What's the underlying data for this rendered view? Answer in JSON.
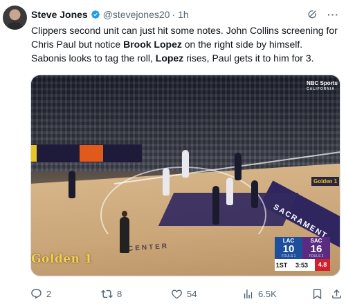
{
  "tweet": {
    "author": {
      "name": "Steve Jones",
      "handle": "@stevejones20",
      "separator": "·",
      "time": "1h",
      "verified": true
    },
    "text_parts": [
      "Clippers second unit can just hit some notes. John Collins screening for Chris Paul but notice ",
      "Brook Lopez",
      " on the right side by himself. Sabonis looks to tag the roll, ",
      "Lopez",
      " rises, Paul gets it to him for 3."
    ],
    "media": {
      "broadcaster": "NBC Sports",
      "broadcaster_region": "CALIFORNIA",
      "court_text": "Golden 1",
      "court_center": "CENTER",
      "sideline_text": "SACRAMENT",
      "arena_sign": "Golden 1",
      "scorebug": {
        "home_abbr": "LAC",
        "home_score": "10",
        "home_fouls": "FOULS 1",
        "away_abbr": "SAC",
        "away_score": "16",
        "away_fouls": "FOULS 2",
        "period": "1ST",
        "clock": "3:53",
        "shot_clock": "4.8"
      }
    },
    "actions": {
      "replies": "2",
      "reposts": "8",
      "likes": "54",
      "views": "6.5K"
    }
  },
  "colors": {
    "verified": "#1d9bf0",
    "text": "#0f1419",
    "secondary": "#536471",
    "lac": "#1d4f9c",
    "sac": "#5b2b82"
  },
  "icons": [
    "verified-badge-icon",
    "grok-icon",
    "more-icon",
    "reply-icon",
    "repost-icon",
    "like-icon",
    "views-icon",
    "bookmark-icon",
    "share-icon"
  ]
}
